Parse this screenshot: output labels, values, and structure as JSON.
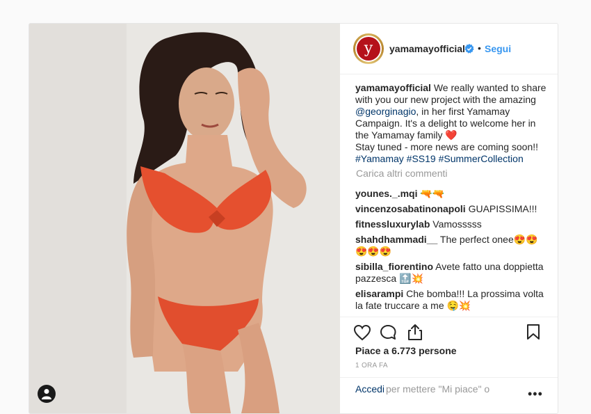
{
  "header": {
    "avatar_letter": "y",
    "username": "yamamayofficial",
    "separator": "•",
    "follow_label": "Segui"
  },
  "caption": {
    "username": "yamamayofficial",
    "text_1": " We really wanted to share with you our new project with the amazing ",
    "mention": "@georginagio",
    "text_2": ", in her first Yamamay Campaign. It's a delight to welcome her in the Yamamay family ❤️",
    "text_3": "Stay tuned - more news are coming soon!!",
    "hashtags": "#Yamamay #SS19 #SummerCollection"
  },
  "load_more_label": "Carica altri commenti",
  "comments": [
    {
      "user": "younes._.mqi",
      "text": " 🔫🔫"
    },
    {
      "user": "vincenzosabatinonapoli",
      "text": " GUAPISSIMA!!!"
    },
    {
      "user": "fitnessluxurylab",
      "text": " Vamosssss"
    },
    {
      "user": "shahdhammadi__",
      "text": " The perfect onee😍😍 😍😍😍"
    },
    {
      "user": "sibilla_fiorentino",
      "text": " Avete fatto una doppietta pazzesca 🔝💥"
    },
    {
      "user": "elisarampi",
      "text": " Che bomba!!! La prossima volta la fate truccare a me 🤤💥"
    }
  ],
  "likes_text": "Piace a 6.773 persone",
  "timestamp": "1 ORA FA",
  "login": {
    "link_label": "Accedi",
    "rest_text": " per mettere \"Mi piace\" o",
    "more_icon": "•••"
  },
  "icons": {
    "verified": "verified-badge-icon",
    "like": "heart-icon",
    "comment": "comment-icon",
    "share": "share-icon",
    "save": "bookmark-icon",
    "user_tag": "user-icon"
  },
  "colors": {
    "accent": "#3897f0",
    "link": "#003569",
    "brand_red": "#b5121b",
    "muted": "#999999"
  }
}
